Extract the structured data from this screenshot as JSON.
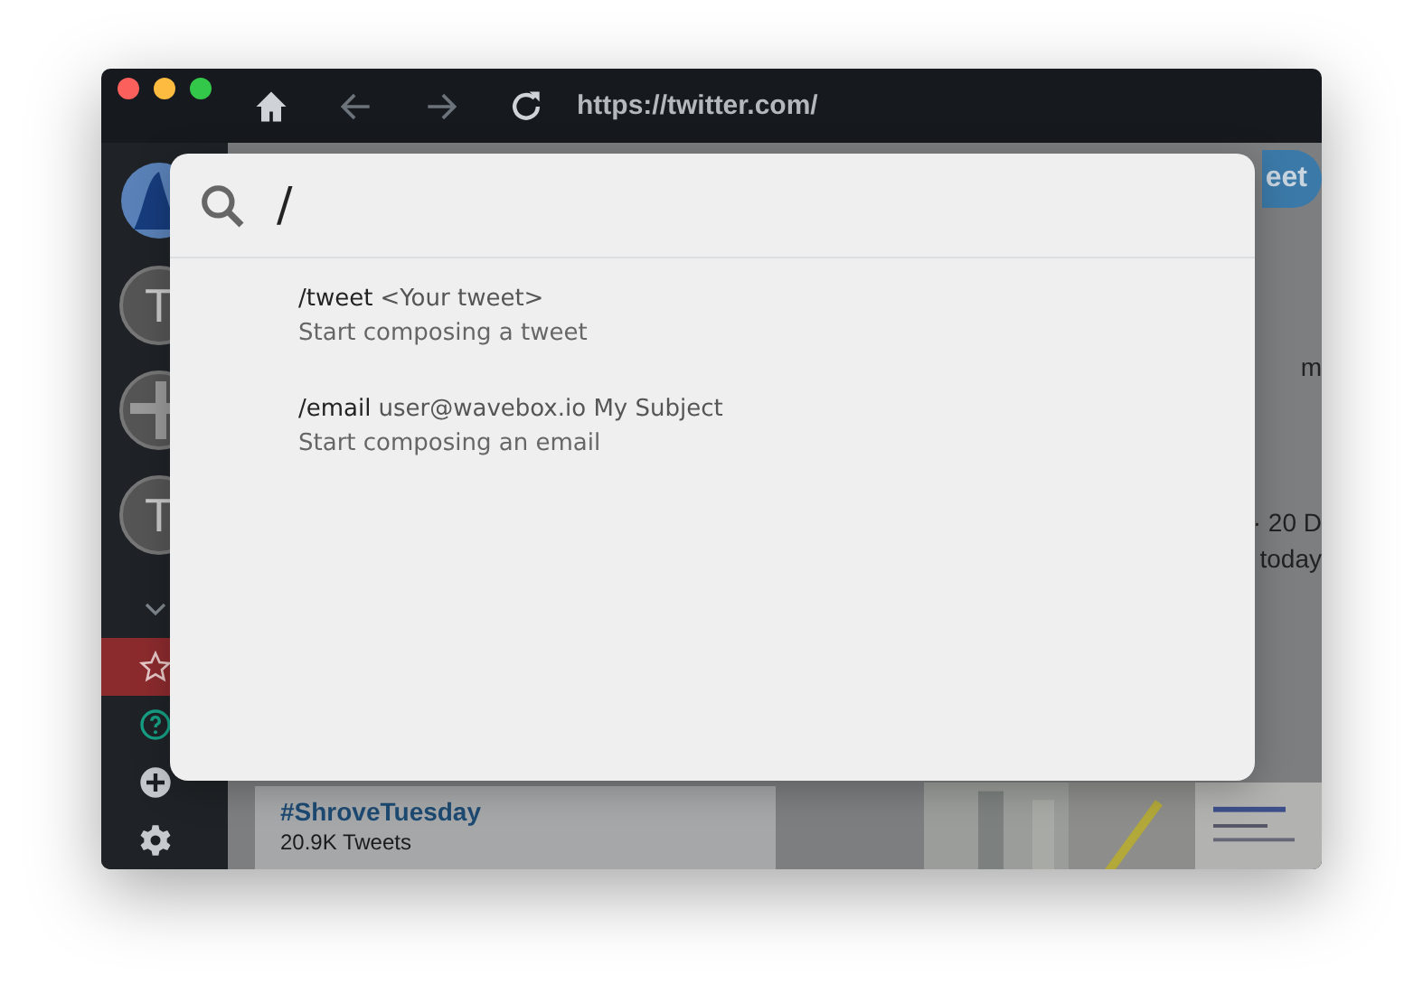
{
  "toolbar": {
    "url": "https://twitter.com/"
  },
  "sidebar": {
    "accounts": [
      {
        "kind": "logo"
      },
      {
        "kind": "letter",
        "letter": "T"
      },
      {
        "kind": "icon"
      },
      {
        "kind": "letter",
        "letter": "T"
      }
    ],
    "tools": [
      {
        "kind": "chevron",
        "selected": false
      },
      {
        "kind": "star",
        "selected": true
      },
      {
        "kind": "help",
        "selected": false
      },
      {
        "kind": "add",
        "selected": false
      },
      {
        "kind": "settings",
        "selected": false
      }
    ]
  },
  "page": {
    "tweet_button": "eet",
    "trend": {
      "tag": "#ShroveTuesday",
      "count": "20.9K Tweets"
    },
    "tweet_fragments": [
      "m",
      "· 20 D",
      "today"
    ],
    "ad_image": {
      "kind": "picture"
    }
  },
  "palette": {
    "query": "/",
    "results": [
      {
        "command": "/tweet",
        "args": "<Your tweet>",
        "description": "Start composing a tweet"
      },
      {
        "command": "/email",
        "args": "user@wavebox.io My Subject",
        "description": "Start composing an email"
      }
    ]
  }
}
